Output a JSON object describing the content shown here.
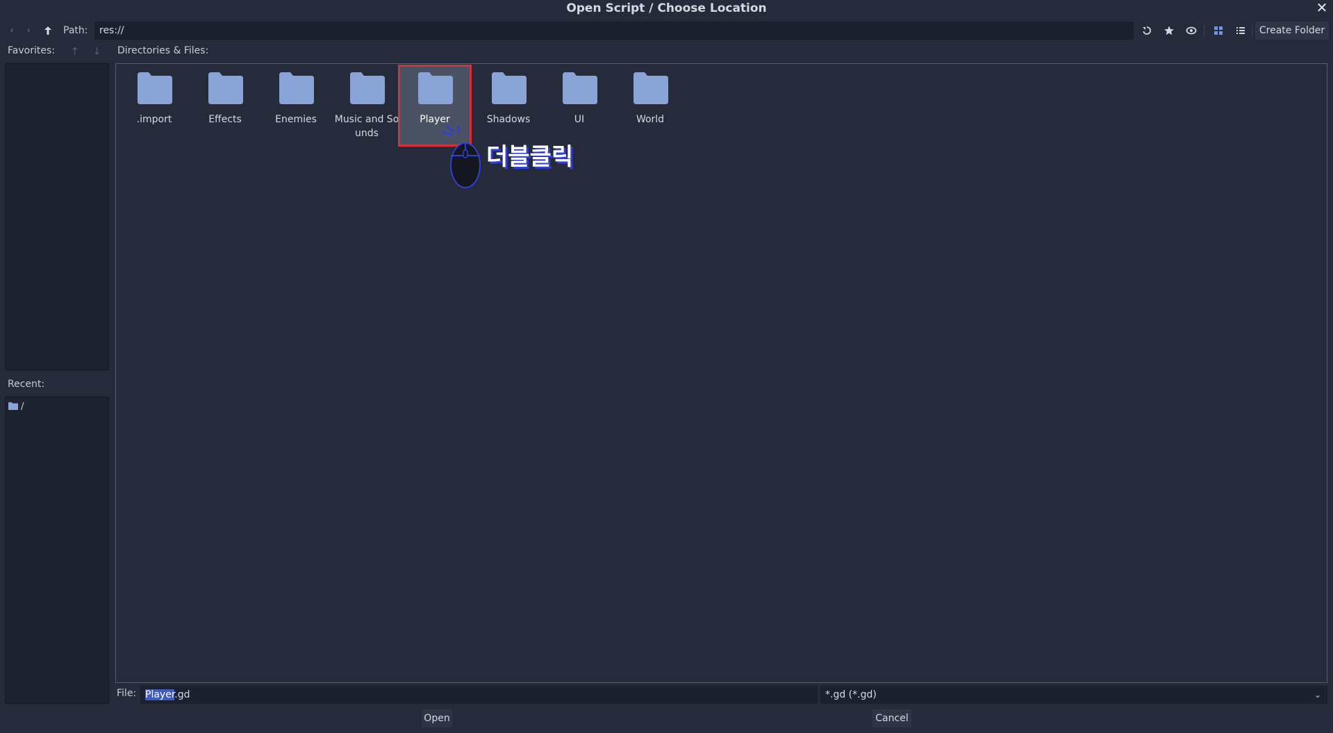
{
  "dialog": {
    "title": "Open Script / Choose Location"
  },
  "toolbar": {
    "path_label": "Path:",
    "path_value": "res://",
    "create_folder_label": "Create Folder"
  },
  "sidebar": {
    "favorites_label": "Favorites:",
    "recent_label": "Recent:",
    "recent_items": [
      {
        "label": "/"
      }
    ]
  },
  "main": {
    "header": "Directories & Files:",
    "items": [
      {
        "name": ".import"
      },
      {
        "name": "Effects"
      },
      {
        "name": "Enemies"
      },
      {
        "name": "Music and So\nunds"
      },
      {
        "name": "Player",
        "selected": true
      },
      {
        "name": "Shadows"
      },
      {
        "name": "UI"
      },
      {
        "name": "World"
      }
    ],
    "annotation": "더블클릭"
  },
  "footer": {
    "file_label": "File:",
    "file_value_selected": "Player",
    "file_value_rest": ".gd",
    "filter_value": "*.gd (*.gd)",
    "open_label": "Open",
    "cancel_label": "Cancel"
  },
  "colors": {
    "background": "#252b3b",
    "folder": "#8aa4d8",
    "selection_outline": "#d8303a",
    "accent": "#3f5bbd"
  }
}
